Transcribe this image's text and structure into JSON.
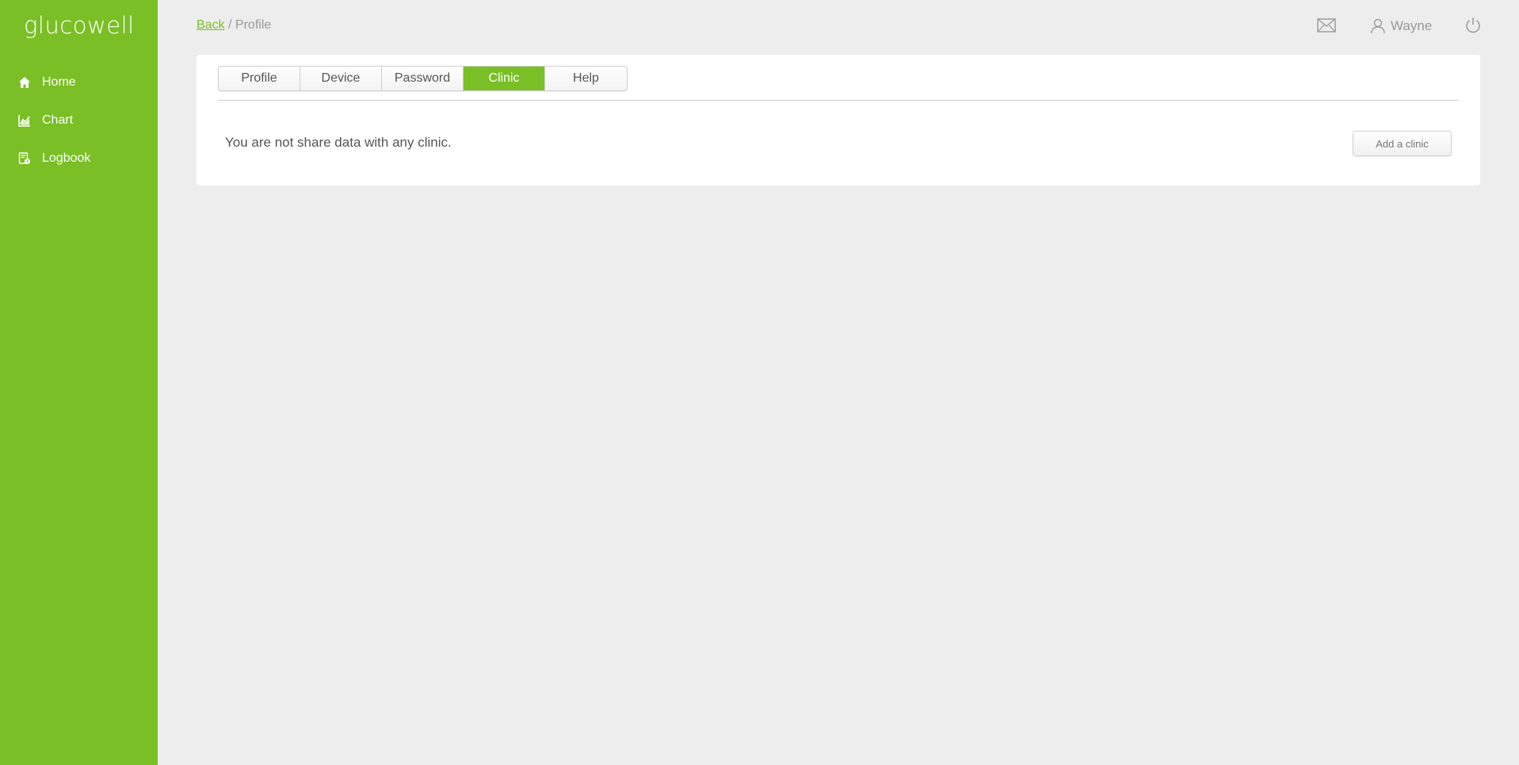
{
  "app": {
    "logo_text": "glucowell",
    "accent_color": "#7abf26"
  },
  "sidebar": {
    "items": [
      {
        "label": "Home",
        "icon": "home-icon"
      },
      {
        "label": "Chart",
        "icon": "chart-icon"
      },
      {
        "label": "Logbook",
        "icon": "logbook-icon"
      }
    ]
  },
  "header": {
    "breadcrumb_back": "Back",
    "breadcrumb_separator": " / ",
    "breadcrumb_current": "Profile",
    "mail_icon": "mail-icon",
    "user_icon": "user-icon",
    "user_name": "Wayne",
    "power_icon": "power-icon"
  },
  "tabs": {
    "items": [
      {
        "label": "Profile"
      },
      {
        "label": "Device"
      },
      {
        "label": "Password"
      },
      {
        "label": "Clinic"
      },
      {
        "label": "Help"
      }
    ],
    "active_index": 3
  },
  "clinic": {
    "empty_message": "You are not share data with any clinic.",
    "add_button_label": "Add a clinic"
  }
}
